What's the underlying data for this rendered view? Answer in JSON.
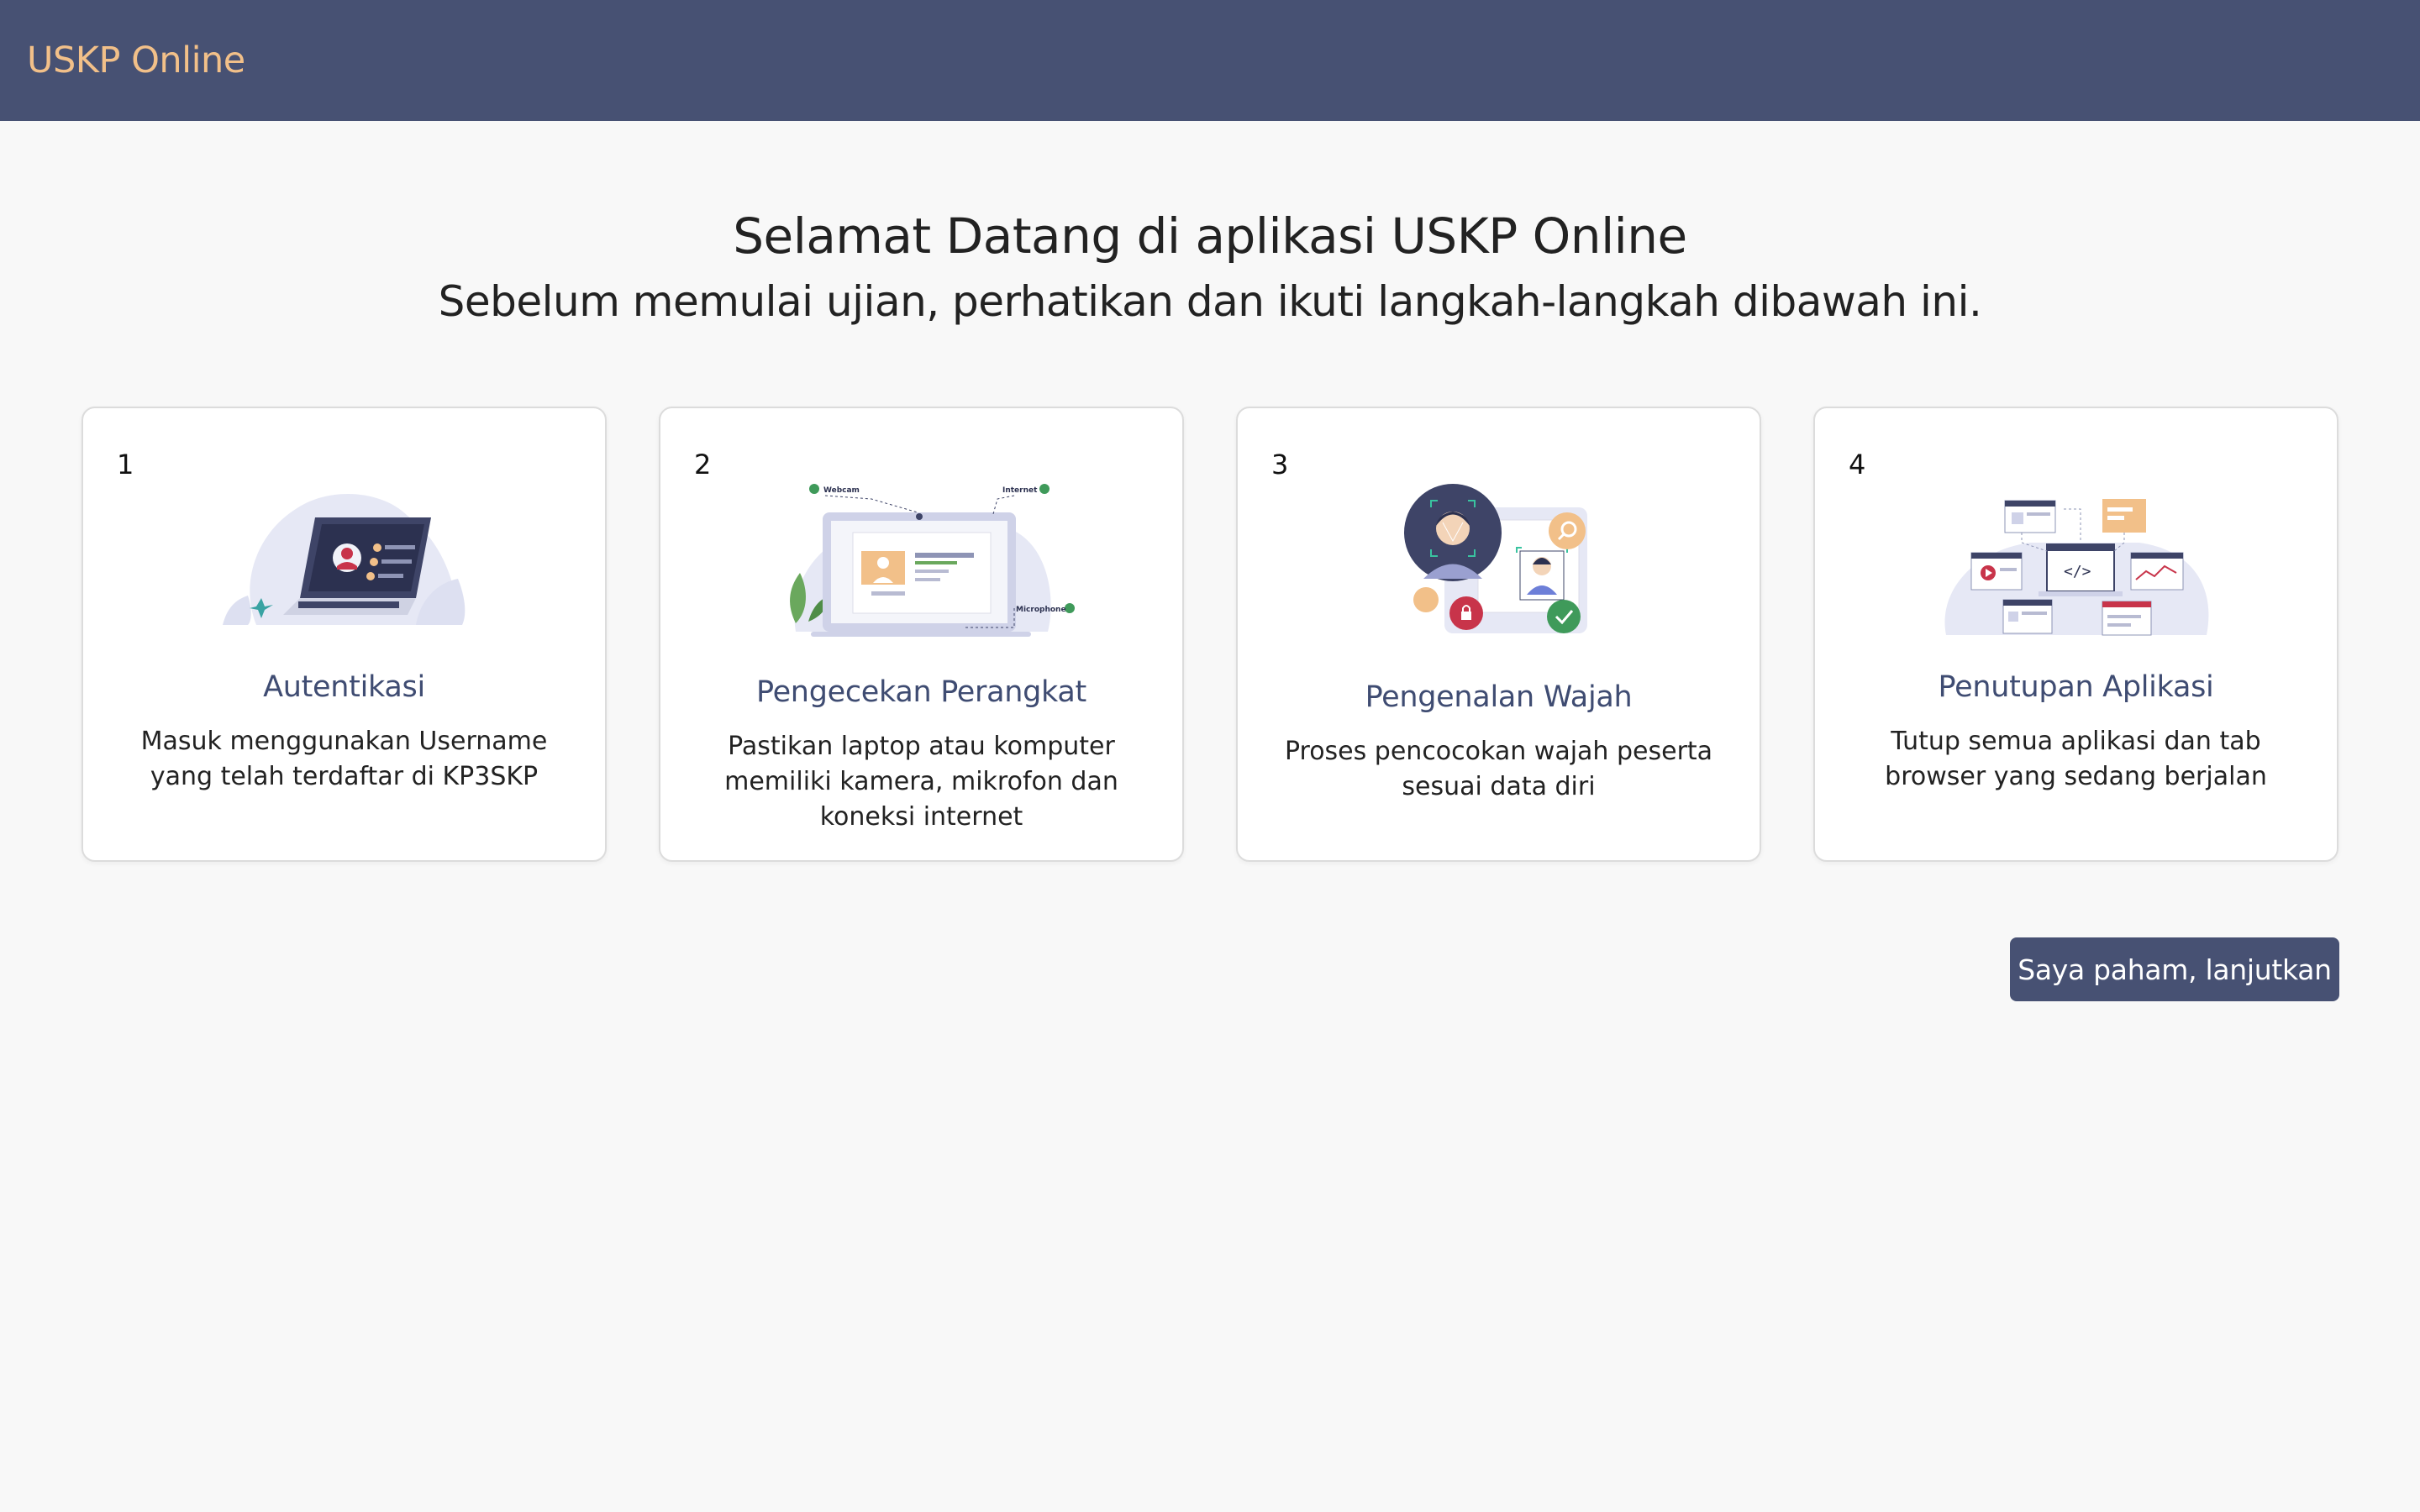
{
  "navbar": {
    "brand": "USKP Online"
  },
  "hero": {
    "title": "Selamat Datang di aplikasi USKP Online",
    "subtitle": "Sebelum memulai ujian, perhatikan dan ikuti langkah-langkah dibawah ini."
  },
  "steps": [
    {
      "number": "1",
      "title": "Autentikasi",
      "description": "Masuk menggunakan Username yang telah terdaftar di KP3SKP",
      "icon": "laptop-login-illustration"
    },
    {
      "number": "2",
      "title": "Pengecekan Perangkat",
      "description": "Pastikan laptop atau komputer memiliki kamera, mikrofon dan koneksi internet",
      "icon": "device-check-illustration",
      "labels": {
        "webcam": "Webcam",
        "internet": "Internet",
        "microphone": "Microphone"
      }
    },
    {
      "number": "3",
      "title": "Pengenalan Wajah",
      "description": "Proses pencocokan wajah peserta sesuai data diri",
      "icon": "face-recognition-illustration"
    },
    {
      "number": "4",
      "title": "Penutupan Aplikasi",
      "description": "Tutup semua aplikasi dan tab browser yang sedang berjalan",
      "icon": "close-apps-illustration"
    }
  ],
  "actions": {
    "continue_label": "Saya paham, lanjutkan"
  },
  "colors": {
    "navbar": "#475173",
    "brand": "#f2c089",
    "accent": "#3f4c72",
    "button": "#475173"
  }
}
